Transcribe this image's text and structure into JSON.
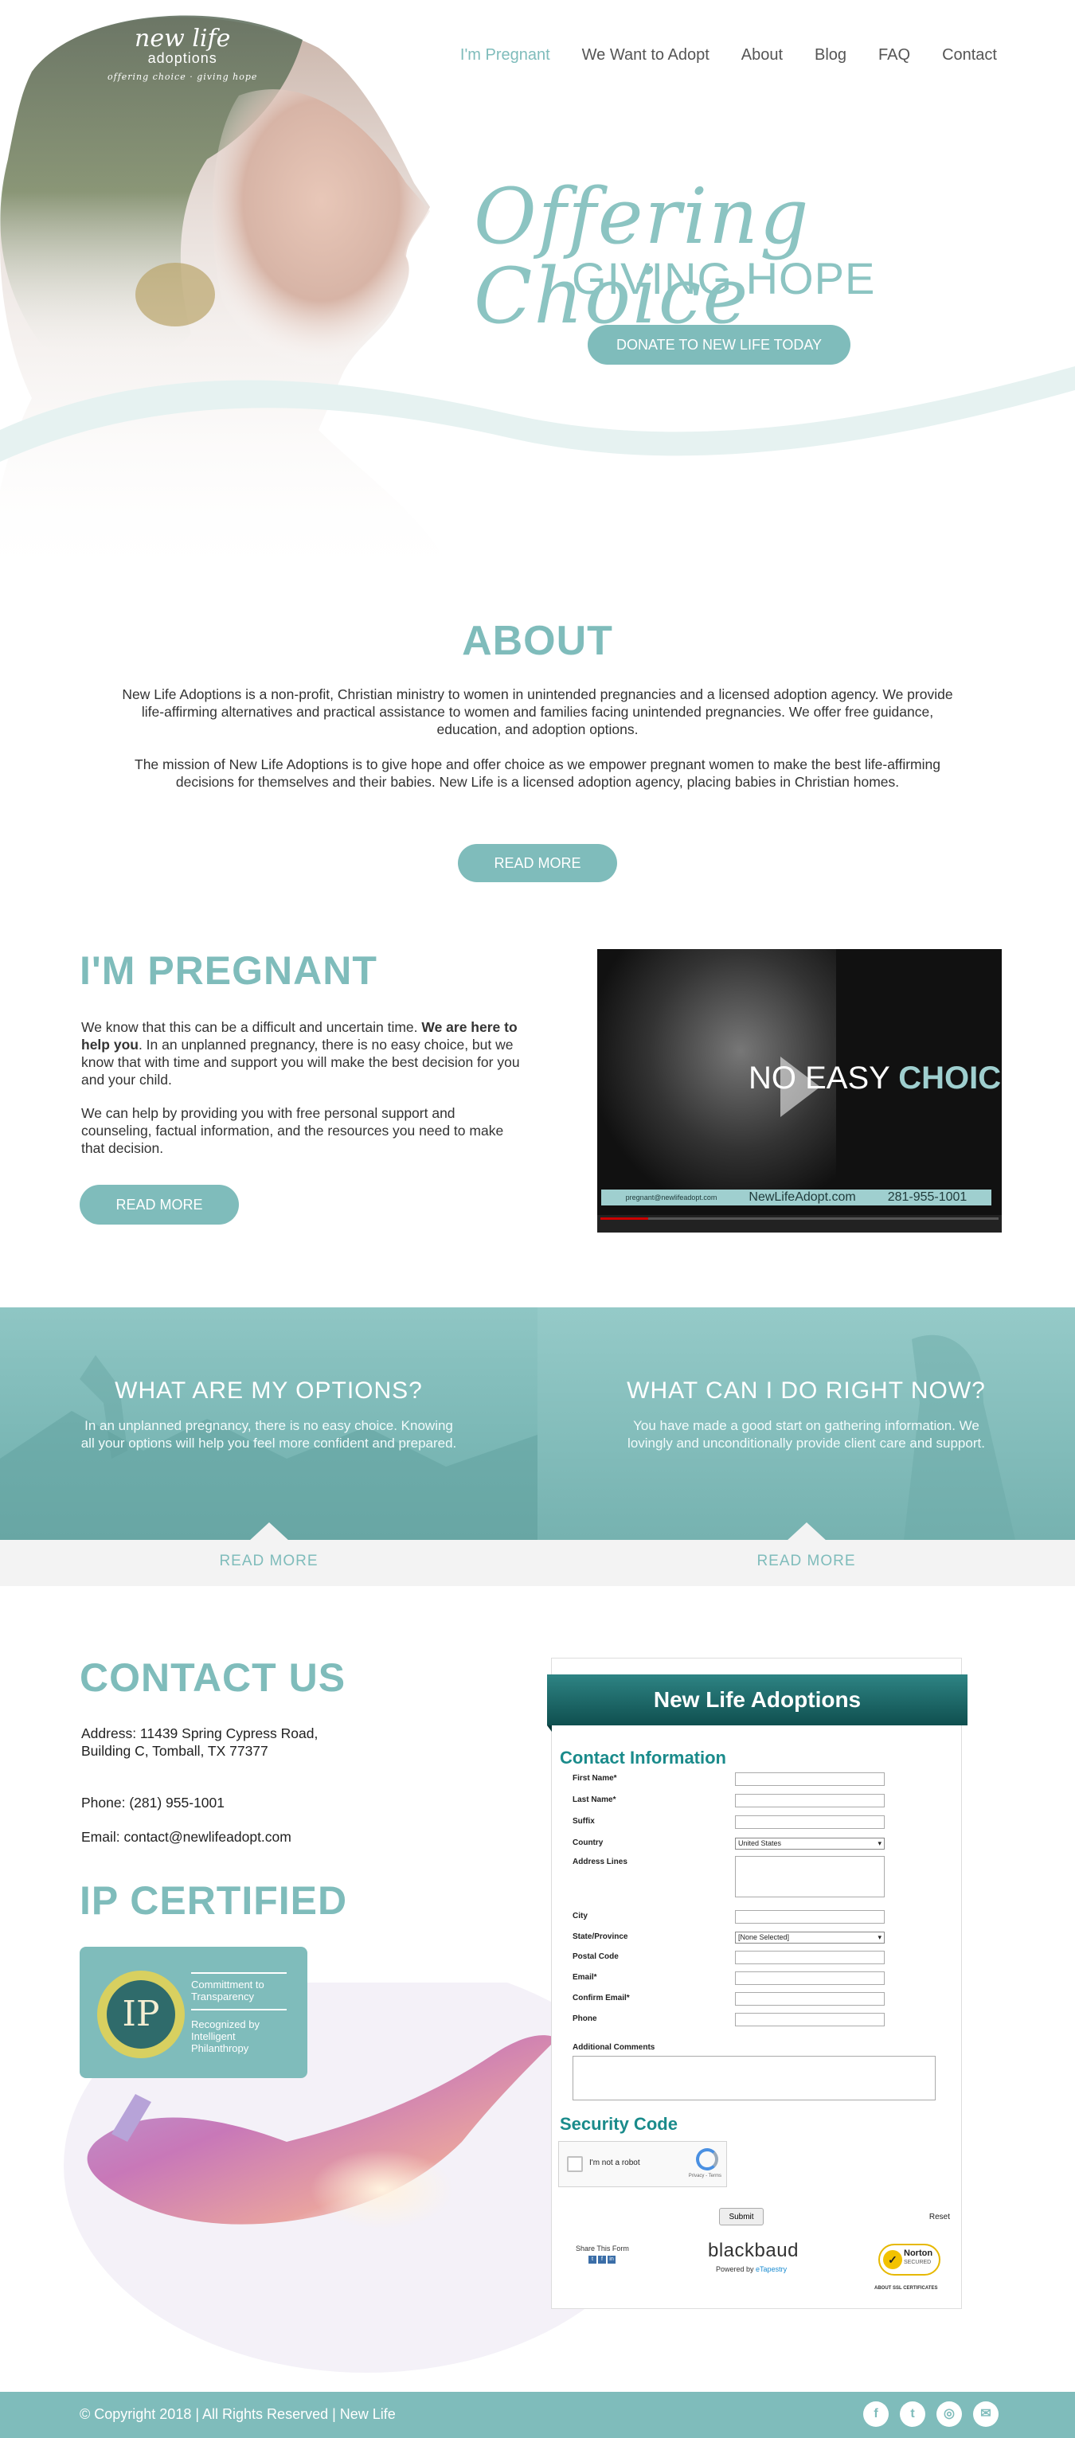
{
  "colors": {
    "accent": "#7fbcbb",
    "footer": "#7fbcbb",
    "form_banner": "#0f4f4f",
    "form_heading": "#1a8b8b"
  },
  "logo": {
    "main": "new life",
    "sub": "adoptions",
    "tagline": "offering choice · giving hope"
  },
  "nav": {
    "items": [
      "I'm Pregnant",
      "We Want to Adopt",
      "About",
      "Blog",
      "FAQ",
      "Contact"
    ],
    "active": "I'm Pregnant"
  },
  "hero": {
    "script": "Offering Choice",
    "sub": "GIVING HOPE",
    "button": "DONATE TO NEW LIFE TODAY"
  },
  "about": {
    "title": "ABOUT",
    "p1": "New Life Adoptions is a non-profit, Christian ministry to women in unintended pregnancies and a licensed adoption agency. We provide life-affirming alternatives and practical assistance to women and families facing unintended pregnancies.  We offer free guidance, education, and adoption options.",
    "p2": "The mission of New Life Adoptions is to give hope and offer choice as we empower pregnant women to make the best life-affirming decisions for themselves and their babies. New Life is a licensed adoption agency, placing babies in Christian homes.",
    "button": "READ MORE"
  },
  "pregnant": {
    "title": "I'M PREGNANT",
    "p1_start": "We know that this can be a difficult and uncertain time. ",
    "p1_bold": "We are here to help you",
    "p1_end": ". In an unplanned pregnancy, there is no easy choice, but we know that with time and support you will make the best decision for you and your child.",
    "p2": "We can help by providing you with free personal support and counseling, factual information, and the resources you need to make that decision.",
    "button": "READ MORE",
    "video": {
      "title_a": "NO EASY ",
      "title_b": "CHOICE!",
      "email": "pregnant@newlifeadopt.com",
      "site": "NewLifeAdopt.com",
      "phone": "281-955-1001"
    }
  },
  "options": [
    {
      "title": "WHAT ARE MY OPTIONS?",
      "text": "In an unplanned pregnancy, there is no easy choice. Knowing all your options will help you feel more confident and prepared.",
      "link": "READ MORE"
    },
    {
      "title": "WHAT CAN I DO RIGHT NOW?",
      "text": "You have made a good start on gathering information. We lovingly and unconditionally provide client care and support.",
      "link": "READ MORE"
    }
  ],
  "contact": {
    "title": "CONTACT US",
    "address": "Address: 11439 Spring Cypress Road, Building C, Tomball, TX 77377",
    "phone": "Phone: (281) 955-1001",
    "email": "Email: contact@newlifeadopt.com"
  },
  "ip": {
    "title": "IP CERTIFIED",
    "seal": "IP",
    "line1": "Committment to Transparency",
    "line2": "Recognized by Intelligent Philanthropy"
  },
  "form": {
    "banner": "New Life Adoptions",
    "section1": "Contact Information",
    "fields": {
      "first_name": "First Name*",
      "last_name": "Last Name*",
      "suffix": "Suffix",
      "country": "Country",
      "country_value": "United States",
      "address": "Address Lines",
      "city": "City",
      "state": "State/Province",
      "state_value": "[None Selected]",
      "postal": "Postal Code",
      "email": "Email*",
      "confirm_email": "Confirm Email*",
      "phone": "Phone",
      "comments": "Additional Comments"
    },
    "section2": "Security Code",
    "captcha_label": "I'm not a robot",
    "captcha_brand": "reCAPTCHA",
    "captcha_terms": "Privacy - Terms",
    "submit": "Submit",
    "reset": "Reset",
    "share": "Share This Form",
    "bb_logo": "blackbaud",
    "bb_powered": "Powered by",
    "bb_link": "eTapestry",
    "norton": "Norton",
    "norton_sub": "SECURED",
    "norton_foot": "ABOUT SSL CERTIFICATES"
  },
  "footer": {
    "copyright": "© Copyright 2018 | All Rights Reserved | New Life",
    "socials": [
      "facebook-icon",
      "twitter-icon",
      "instagram-icon",
      "email-icon"
    ]
  }
}
